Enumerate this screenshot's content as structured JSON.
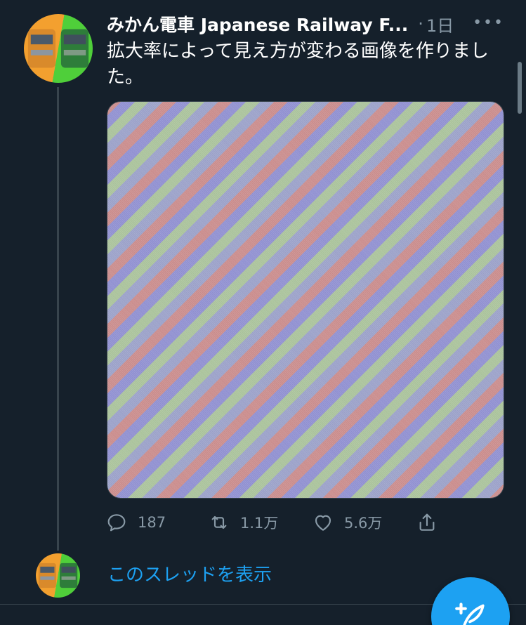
{
  "tweet": {
    "display_name": "みかん電車 Japanese Railway F...",
    "separator": "·",
    "timestamp": "1日",
    "more_label": "•••",
    "text": "拡大率によって見え方が変わる画像を作りました。",
    "actions": {
      "reply_count": "187",
      "retweet_count": "1.1万",
      "like_count": "5.6万"
    }
  },
  "thread": {
    "show_thread_label": "このスレッドを表示"
  },
  "colors": {
    "background": "#15202b",
    "accent": "#1da1f2",
    "muted": "#8899a6",
    "border": "#38444d"
  },
  "icons": {
    "reply": "reply-icon",
    "retweet": "retweet-icon",
    "like": "heart-icon",
    "share": "share-icon",
    "compose": "compose-tweet-icon"
  }
}
